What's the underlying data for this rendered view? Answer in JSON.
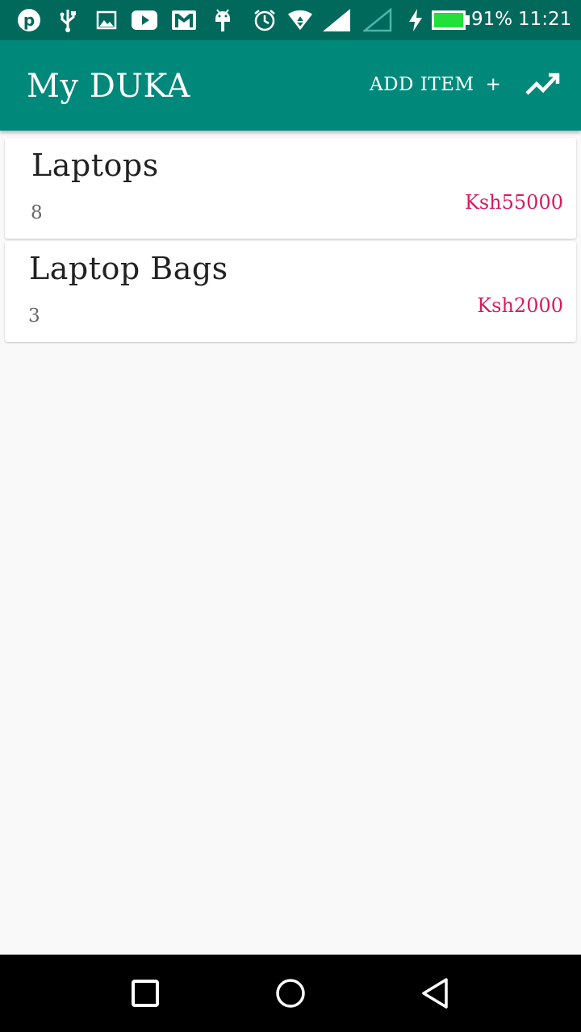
{
  "status_bar": {
    "battery_percent": "91%",
    "time": "11:21",
    "battery_color": "#22e03a",
    "icons": [
      "pinterest-icon",
      "usb-icon",
      "image-icon",
      "youtube-icon",
      "gmail-icon",
      "android-icon",
      "alarm-icon",
      "wifi-icon",
      "signal-icon",
      "signal-empty-icon",
      "charging-icon",
      "battery-icon"
    ]
  },
  "app_bar": {
    "title": "My DUKA",
    "add_item_label": "ADD ITEM",
    "add_item_plus": "+",
    "trend_icon": "trending-up-icon",
    "color": "#00897b"
  },
  "items": [
    {
      "name": "Laptops",
      "quantity": "8",
      "price": "Ksh55000"
    },
    {
      "name": "Laptop Bags",
      "quantity": "3",
      "price": "Ksh2000"
    }
  ],
  "nav_bar": {
    "buttons": [
      "recents-button",
      "home-button",
      "back-button"
    ]
  },
  "colors": {
    "price": "#d81b60",
    "status_bar": "#00695c"
  }
}
